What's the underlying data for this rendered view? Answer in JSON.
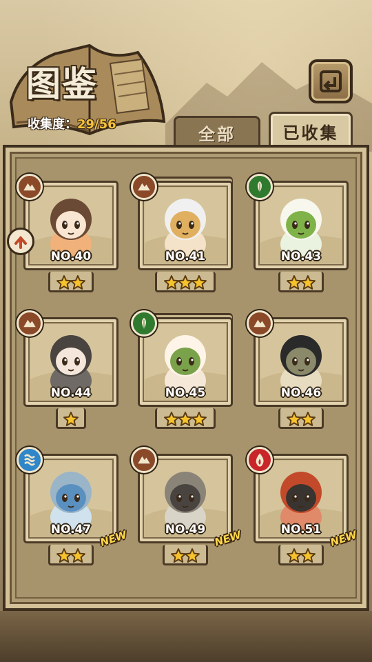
{
  "header": {
    "title": "图鉴",
    "collection_label": "收集度：",
    "collection_value": "29/56"
  },
  "tabs": [
    {
      "label": "全部",
      "active": false
    },
    {
      "label": "已收集",
      "active": true
    }
  ],
  "icons": {
    "back": "back-return-icon",
    "side": "side-arrow-icon"
  },
  "elements": {
    "earth": {
      "name": "earth-element-icon",
      "color": "#8a4a2a"
    },
    "nature": {
      "name": "nature-element-icon",
      "color": "#2f7a2f"
    },
    "water": {
      "name": "water-element-icon",
      "color": "#2f86c9"
    },
    "fire": {
      "name": "fire-element-icon",
      "color": "#c8262a"
    }
  },
  "cards": [
    {
      "no": "NO.40",
      "element": "earth",
      "stars": 2,
      "is_new": false
    },
    {
      "no": "NO.41",
      "element": "earth",
      "stars": 3,
      "is_new": false
    },
    {
      "no": "NO.43",
      "element": "nature",
      "stars": 2,
      "is_new": false
    },
    {
      "no": "NO.44",
      "element": "earth",
      "stars": 1,
      "is_new": false
    },
    {
      "no": "NO.45",
      "element": "nature",
      "stars": 3,
      "is_new": false
    },
    {
      "no": "NO.46",
      "element": "earth",
      "stars": 2,
      "is_new": false
    },
    {
      "no": "NO.47",
      "element": "water",
      "stars": 2,
      "is_new": true,
      "new_label": "NEW"
    },
    {
      "no": "NO.49",
      "element": "earth",
      "stars": 2,
      "is_new": true,
      "new_label": "NEW"
    },
    {
      "no": "NO.51",
      "element": "fire",
      "stars": 2,
      "is_new": true,
      "new_label": "NEW"
    }
  ]
}
